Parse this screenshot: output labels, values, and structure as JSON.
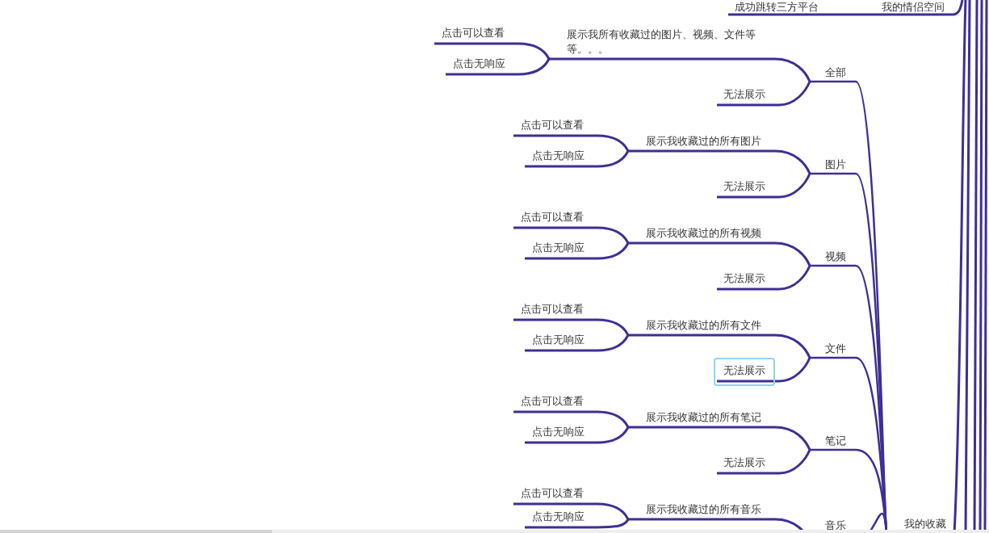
{
  "mindmap": {
    "top_branch": [
      {
        "text": "成功跳转三方平台"
      },
      {
        "text": "我的情侣空间"
      }
    ],
    "root": {
      "text": "我的收藏",
      "children": [
        {
          "text": "全部",
          "children": [
            {
              "text": "展示我所有收藏过的图片、视频、文件等等。。。",
              "children": [
                {
                  "text": "点击可以查看"
                },
                {
                  "text": "点击无响应"
                }
              ]
            },
            {
              "text": "无法展示",
              "selected": false
            }
          ]
        },
        {
          "text": "图片",
          "children": [
            {
              "text": "展示我收藏过的所有图片",
              "children": [
                {
                  "text": "点击可以查看"
                },
                {
                  "text": "点击无响应"
                }
              ]
            },
            {
              "text": "无法展示",
              "selected": false
            }
          ]
        },
        {
          "text": "视频",
          "children": [
            {
              "text": "展示我收藏过的所有视频",
              "children": [
                {
                  "text": "点击可以查看"
                },
                {
                  "text": "点击无响应"
                }
              ]
            },
            {
              "text": "无法展示",
              "selected": false
            }
          ]
        },
        {
          "text": "文件",
          "children": [
            {
              "text": "展示我收藏过的所有文件",
              "children": [
                {
                  "text": "点击可以查看"
                },
                {
                  "text": "点击无响应"
                }
              ]
            },
            {
              "text": "无法展示",
              "selected": true
            }
          ]
        },
        {
          "text": "笔记",
          "children": [
            {
              "text": "展示我收藏过的所有笔记",
              "children": [
                {
                  "text": "点击可以查看"
                },
                {
                  "text": "点击无响应"
                }
              ]
            },
            {
              "text": "无法展示",
              "selected": false
            }
          ]
        },
        {
          "text": "音乐",
          "children": [
            {
              "text": "展示我收藏过的所有音乐",
              "children": [
                {
                  "text": "点击可以查看"
                },
                {
                  "text": "点击无响应"
                }
              ]
            }
          ]
        }
      ]
    }
  }
}
